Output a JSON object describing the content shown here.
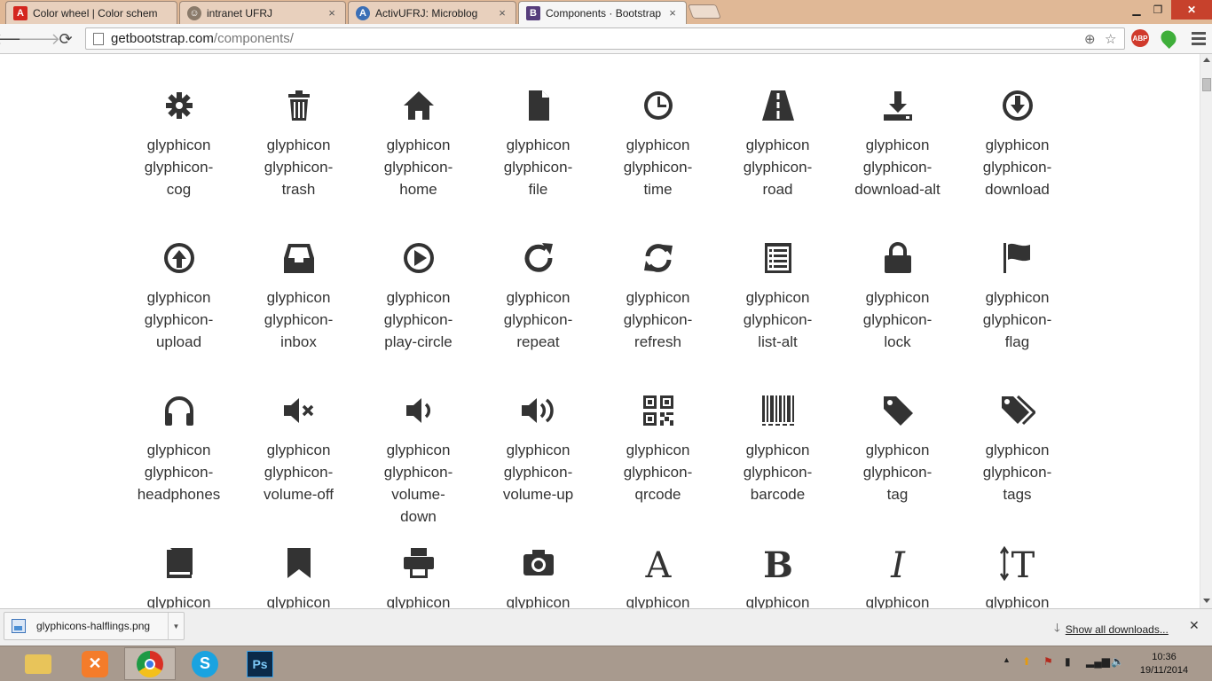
{
  "browser": {
    "tabs": [
      {
        "title": "Color wheel | Color schem",
        "favicon": "adobe-icon",
        "active": false
      },
      {
        "title": "intranet UFRJ",
        "favicon": "ufrj-icon",
        "active": false
      },
      {
        "title": "ActivUFRJ: Microblog",
        "favicon": "activ-icon",
        "active": false
      },
      {
        "title": "Components · Bootstrap",
        "favicon": "bootstrap-icon",
        "active": true
      }
    ],
    "url_host": "getbootstrap.com",
    "url_path": "/components/",
    "abp_badge": "ABP"
  },
  "glyphs": {
    "prefix": "glyphicon",
    "items": [
      {
        "name": "glyphicon-cog",
        "label": [
          "glyphicon",
          "glyphicon-",
          "cog"
        ],
        "icon": "cog-icon"
      },
      {
        "name": "glyphicon-trash",
        "label": [
          "glyphicon",
          "glyphicon-",
          "trash"
        ],
        "icon": "trash-icon"
      },
      {
        "name": "glyphicon-home",
        "label": [
          "glyphicon",
          "glyphicon-",
          "home"
        ],
        "icon": "home-icon"
      },
      {
        "name": "glyphicon-file",
        "label": [
          "glyphicon",
          "glyphicon-",
          "file"
        ],
        "icon": "file-icon"
      },
      {
        "name": "glyphicon-time",
        "label": [
          "glyphicon",
          "glyphicon-",
          "time"
        ],
        "icon": "time-icon"
      },
      {
        "name": "glyphicon-road",
        "label": [
          "glyphicon",
          "glyphicon-",
          "road"
        ],
        "icon": "road-icon"
      },
      {
        "name": "glyphicon-download-alt",
        "label": [
          "glyphicon",
          "glyphicon-",
          "download-alt"
        ],
        "icon": "download-alt-icon"
      },
      {
        "name": "glyphicon-download",
        "label": [
          "glyphicon",
          "glyphicon-",
          "download"
        ],
        "icon": "download-icon"
      },
      {
        "name": "glyphicon-upload",
        "label": [
          "glyphicon",
          "glyphicon-",
          "upload"
        ],
        "icon": "upload-icon"
      },
      {
        "name": "glyphicon-inbox",
        "label": [
          "glyphicon",
          "glyphicon-",
          "inbox"
        ],
        "icon": "inbox-icon"
      },
      {
        "name": "glyphicon-play-circle",
        "label": [
          "glyphicon",
          "glyphicon-",
          "play-circle"
        ],
        "icon": "play-circle-icon"
      },
      {
        "name": "glyphicon-repeat",
        "label": [
          "glyphicon",
          "glyphicon-",
          "repeat"
        ],
        "icon": "repeat-icon"
      },
      {
        "name": "glyphicon-refresh",
        "label": [
          "glyphicon",
          "glyphicon-",
          "refresh"
        ],
        "icon": "refresh-icon"
      },
      {
        "name": "glyphicon-list-alt",
        "label": [
          "glyphicon",
          "glyphicon-",
          "list-alt"
        ],
        "icon": "list-alt-icon"
      },
      {
        "name": "glyphicon-lock",
        "label": [
          "glyphicon",
          "glyphicon-",
          "lock"
        ],
        "icon": "lock-icon"
      },
      {
        "name": "glyphicon-flag",
        "label": [
          "glyphicon",
          "glyphicon-",
          "flag"
        ],
        "icon": "flag-icon"
      },
      {
        "name": "glyphicon-headphones",
        "label": [
          "glyphicon",
          "glyphicon-",
          "headphones"
        ],
        "icon": "headphones-icon"
      },
      {
        "name": "glyphicon-volume-off",
        "label": [
          "glyphicon",
          "glyphicon-",
          "volume-off"
        ],
        "icon": "volume-off-icon"
      },
      {
        "name": "glyphicon-volume-down",
        "label": [
          "glyphicon",
          "glyphicon-",
          "volume-",
          "down"
        ],
        "icon": "volume-down-icon"
      },
      {
        "name": "glyphicon-volume-up",
        "label": [
          "glyphicon",
          "glyphicon-",
          "volume-up"
        ],
        "icon": "volume-up-icon"
      },
      {
        "name": "glyphicon-qrcode",
        "label": [
          "glyphicon",
          "glyphicon-",
          "qrcode"
        ],
        "icon": "qrcode-icon"
      },
      {
        "name": "glyphicon-barcode",
        "label": [
          "glyphicon",
          "glyphicon-",
          "barcode"
        ],
        "icon": "barcode-icon"
      },
      {
        "name": "glyphicon-tag",
        "label": [
          "glyphicon",
          "glyphicon-",
          "tag"
        ],
        "icon": "tag-icon"
      },
      {
        "name": "glyphicon-tags",
        "label": [
          "glyphicon",
          "glyphicon-",
          "tags"
        ],
        "icon": "tags-icon"
      },
      {
        "name": "glyphicon-book",
        "label": [
          "glyphicon"
        ],
        "icon": "book-icon"
      },
      {
        "name": "glyphicon-bookmark",
        "label": [
          "glyphicon"
        ],
        "icon": "bookmark-icon"
      },
      {
        "name": "glyphicon-print",
        "label": [
          "glyphicon"
        ],
        "icon": "print-icon"
      },
      {
        "name": "glyphicon-camera",
        "label": [
          "glyphicon"
        ],
        "icon": "camera-icon"
      },
      {
        "name": "glyphicon-font",
        "label": [
          "glyphicon"
        ],
        "icon": "font-icon"
      },
      {
        "name": "glyphicon-bold",
        "label": [
          "glyphicon"
        ],
        "icon": "bold-icon"
      },
      {
        "name": "glyphicon-italic",
        "label": [
          "glyphicon"
        ],
        "icon": "italic-icon"
      },
      {
        "name": "glyphicon-text-height",
        "label": [
          "glyphicon"
        ],
        "icon": "text-height-icon"
      }
    ],
    "icon_color": "#333333"
  },
  "downloads": {
    "file_name": "glyphicons-halflings.png",
    "show_all": "Show all downloads..."
  },
  "taskbar": {
    "apps": [
      "file-explorer-icon",
      "xampp-icon",
      "chrome-icon",
      "skype-icon",
      "photoshop-icon"
    ],
    "photoshop_label": "Ps",
    "time": "10:36",
    "date": "19/11/2014"
  },
  "colors": {
    "tab_strip": "#e0b896",
    "taskbar": "#a89a8e",
    "close_button": "#c7412c",
    "text": "#333333"
  }
}
